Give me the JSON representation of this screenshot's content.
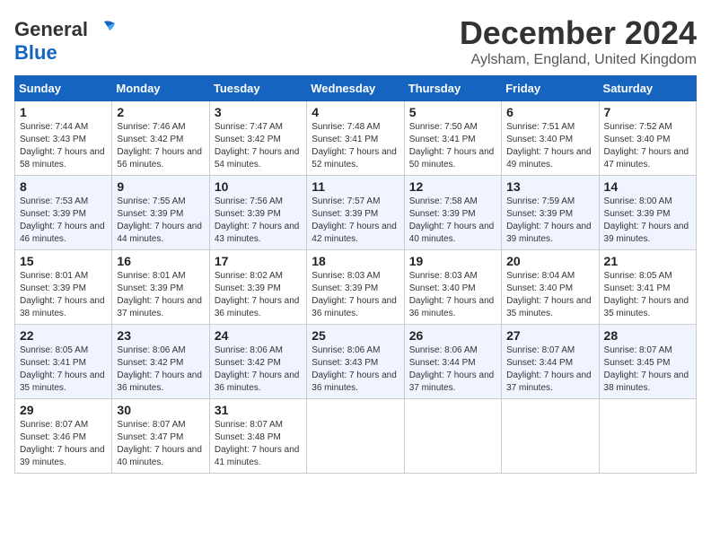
{
  "header": {
    "logo_general": "General",
    "logo_blue": "Blue",
    "month": "December 2024",
    "location": "Aylsham, England, United Kingdom"
  },
  "weekdays": [
    "Sunday",
    "Monday",
    "Tuesday",
    "Wednesday",
    "Thursday",
    "Friday",
    "Saturday"
  ],
  "weeks": [
    [
      {
        "day": "1",
        "sunrise": "7:44 AM",
        "sunset": "3:43 PM",
        "daylight": "7 hours and 58 minutes."
      },
      {
        "day": "2",
        "sunrise": "7:46 AM",
        "sunset": "3:42 PM",
        "daylight": "7 hours and 56 minutes."
      },
      {
        "day": "3",
        "sunrise": "7:47 AM",
        "sunset": "3:42 PM",
        "daylight": "7 hours and 54 minutes."
      },
      {
        "day": "4",
        "sunrise": "7:48 AM",
        "sunset": "3:41 PM",
        "daylight": "7 hours and 52 minutes."
      },
      {
        "day": "5",
        "sunrise": "7:50 AM",
        "sunset": "3:41 PM",
        "daylight": "7 hours and 50 minutes."
      },
      {
        "day": "6",
        "sunrise": "7:51 AM",
        "sunset": "3:40 PM",
        "daylight": "7 hours and 49 minutes."
      },
      {
        "day": "7",
        "sunrise": "7:52 AM",
        "sunset": "3:40 PM",
        "daylight": "7 hours and 47 minutes."
      }
    ],
    [
      {
        "day": "8",
        "sunrise": "7:53 AM",
        "sunset": "3:39 PM",
        "daylight": "7 hours and 46 minutes."
      },
      {
        "day": "9",
        "sunrise": "7:55 AM",
        "sunset": "3:39 PM",
        "daylight": "7 hours and 44 minutes."
      },
      {
        "day": "10",
        "sunrise": "7:56 AM",
        "sunset": "3:39 PM",
        "daylight": "7 hours and 43 minutes."
      },
      {
        "day": "11",
        "sunrise": "7:57 AM",
        "sunset": "3:39 PM",
        "daylight": "7 hours and 42 minutes."
      },
      {
        "day": "12",
        "sunrise": "7:58 AM",
        "sunset": "3:39 PM",
        "daylight": "7 hours and 40 minutes."
      },
      {
        "day": "13",
        "sunrise": "7:59 AM",
        "sunset": "3:39 PM",
        "daylight": "7 hours and 39 minutes."
      },
      {
        "day": "14",
        "sunrise": "8:00 AM",
        "sunset": "3:39 PM",
        "daylight": "7 hours and 39 minutes."
      }
    ],
    [
      {
        "day": "15",
        "sunrise": "8:01 AM",
        "sunset": "3:39 PM",
        "daylight": "7 hours and 38 minutes."
      },
      {
        "day": "16",
        "sunrise": "8:01 AM",
        "sunset": "3:39 PM",
        "daylight": "7 hours and 37 minutes."
      },
      {
        "day": "17",
        "sunrise": "8:02 AM",
        "sunset": "3:39 PM",
        "daylight": "7 hours and 36 minutes."
      },
      {
        "day": "18",
        "sunrise": "8:03 AM",
        "sunset": "3:39 PM",
        "daylight": "7 hours and 36 minutes."
      },
      {
        "day": "19",
        "sunrise": "8:03 AM",
        "sunset": "3:40 PM",
        "daylight": "7 hours and 36 minutes."
      },
      {
        "day": "20",
        "sunrise": "8:04 AM",
        "sunset": "3:40 PM",
        "daylight": "7 hours and 35 minutes."
      },
      {
        "day": "21",
        "sunrise": "8:05 AM",
        "sunset": "3:41 PM",
        "daylight": "7 hours and 35 minutes."
      }
    ],
    [
      {
        "day": "22",
        "sunrise": "8:05 AM",
        "sunset": "3:41 PM",
        "daylight": "7 hours and 35 minutes."
      },
      {
        "day": "23",
        "sunrise": "8:06 AM",
        "sunset": "3:42 PM",
        "daylight": "7 hours and 36 minutes."
      },
      {
        "day": "24",
        "sunrise": "8:06 AM",
        "sunset": "3:42 PM",
        "daylight": "7 hours and 36 minutes."
      },
      {
        "day": "25",
        "sunrise": "8:06 AM",
        "sunset": "3:43 PM",
        "daylight": "7 hours and 36 minutes."
      },
      {
        "day": "26",
        "sunrise": "8:06 AM",
        "sunset": "3:44 PM",
        "daylight": "7 hours and 37 minutes."
      },
      {
        "day": "27",
        "sunrise": "8:07 AM",
        "sunset": "3:44 PM",
        "daylight": "7 hours and 37 minutes."
      },
      {
        "day": "28",
        "sunrise": "8:07 AM",
        "sunset": "3:45 PM",
        "daylight": "7 hours and 38 minutes."
      }
    ],
    [
      {
        "day": "29",
        "sunrise": "8:07 AM",
        "sunset": "3:46 PM",
        "daylight": "7 hours and 39 minutes."
      },
      {
        "day": "30",
        "sunrise": "8:07 AM",
        "sunset": "3:47 PM",
        "daylight": "7 hours and 40 minutes."
      },
      {
        "day": "31",
        "sunrise": "8:07 AM",
        "sunset": "3:48 PM",
        "daylight": "7 hours and 41 minutes."
      },
      null,
      null,
      null,
      null
    ]
  ],
  "labels": {
    "sunrise": "Sunrise:",
    "sunset": "Sunset:",
    "daylight": "Daylight:"
  }
}
